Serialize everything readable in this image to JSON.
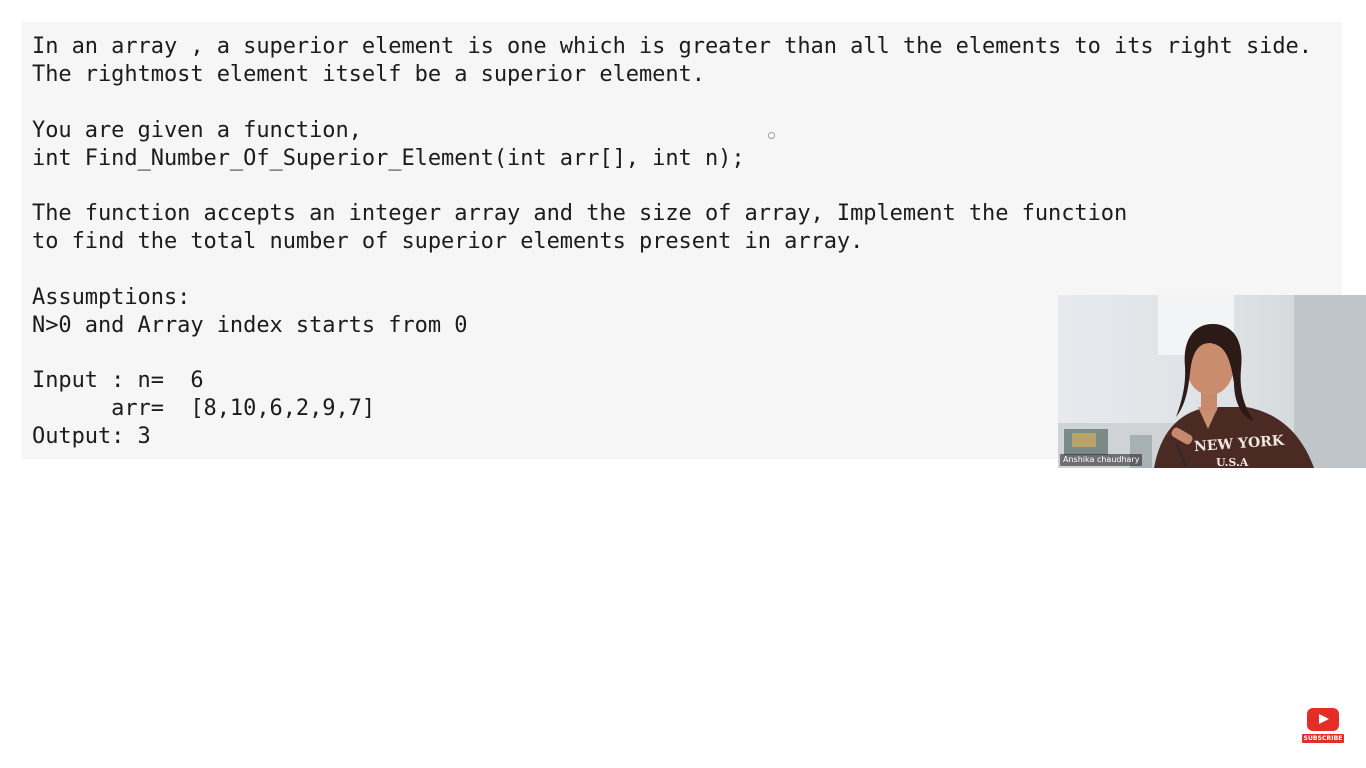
{
  "problem": {
    "lines": [
      "In an array , a superior element is one which is greater than all the elements to its right side.",
      "The rightmost element itself be a superior element.",
      "You are given a function,",
      "int Find_Number_Of_Superior_Element(int arr[], int n);",
      "The function accepts an integer array and the size of array, Implement the function",
      "to find the total number of superior elements present in array.",
      "Assumptions:",
      "N>0 and Array index starts from 0",
      "Input : n=  6",
      "      arr=  [8,10,6,2,9,7]",
      "Output: 3"
    ]
  },
  "webcam": {
    "presenter_name": "Anshika chaudhary",
    "shirt_text_line1": "NEW YORK",
    "shirt_text_line2": "U.S.A"
  },
  "subscribe": {
    "label": "SUBSCRIBE",
    "icon": "youtube-play-icon",
    "color": "#e52d27"
  }
}
